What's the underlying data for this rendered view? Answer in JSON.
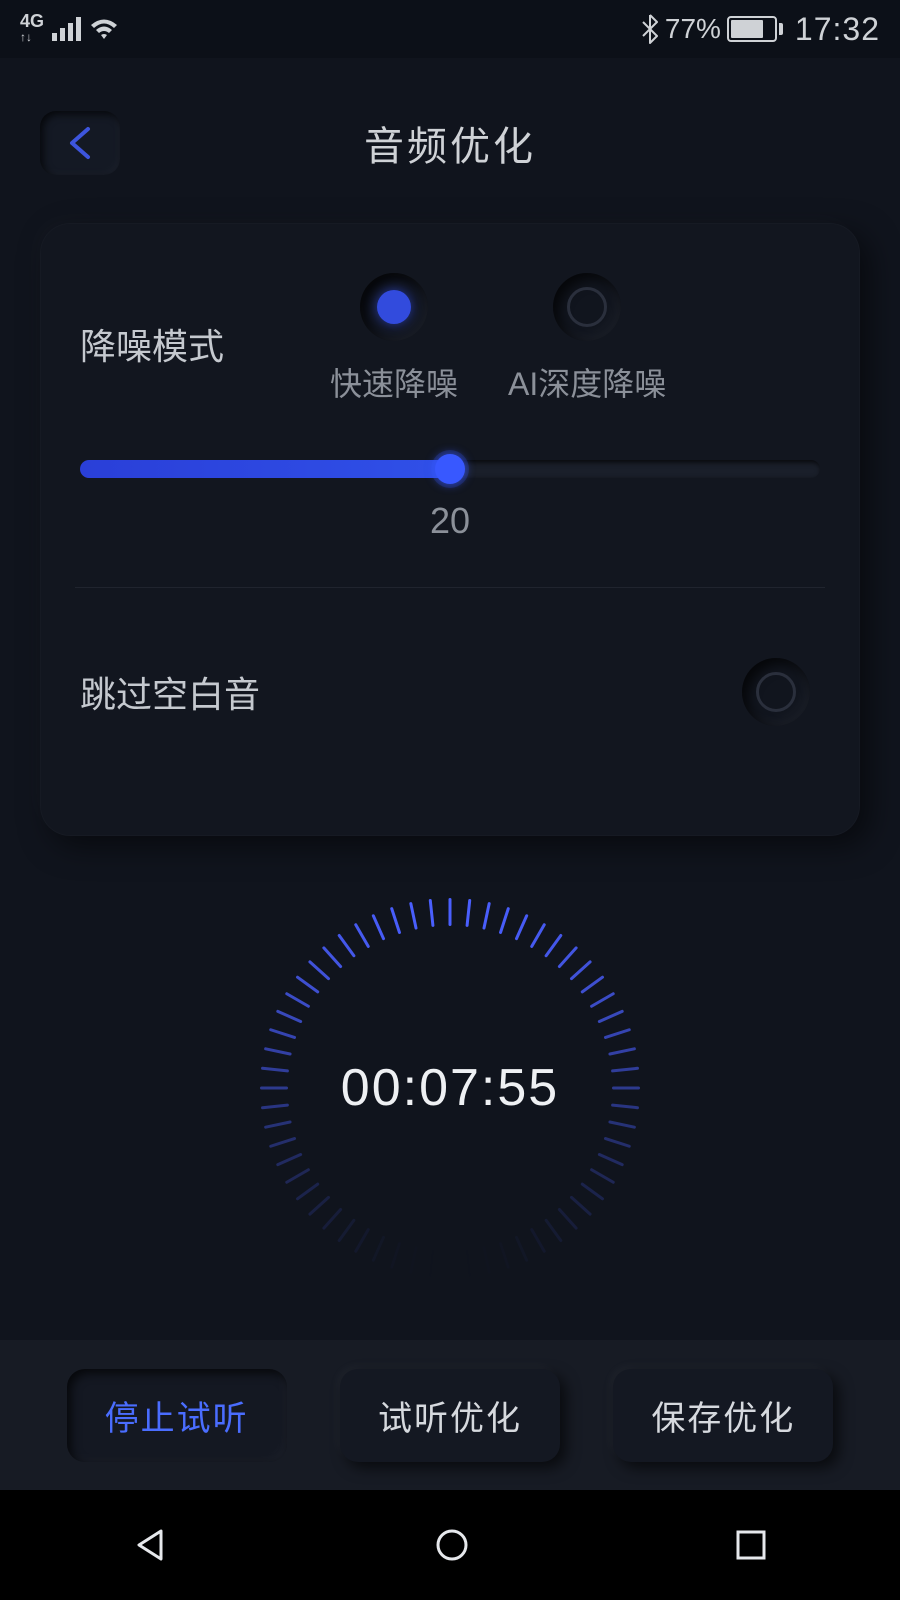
{
  "statusbar": {
    "network_label": "4G",
    "battery_percent": "77%",
    "clock": "17:32"
  },
  "header": {
    "title": "音频优化"
  },
  "noise": {
    "label": "降噪模式",
    "option_fast": "快速降噪",
    "option_ai": "AI深度降噪",
    "selected": "fast",
    "slider_value": "20",
    "slider_percent": 50
  },
  "skip": {
    "label": "跳过空白音",
    "checked": false
  },
  "timer": {
    "display": "00:07:55"
  },
  "buttons": {
    "stop_preview": "停止试听",
    "preview_opt": "试听优化",
    "save_opt": "保存优化"
  }
}
